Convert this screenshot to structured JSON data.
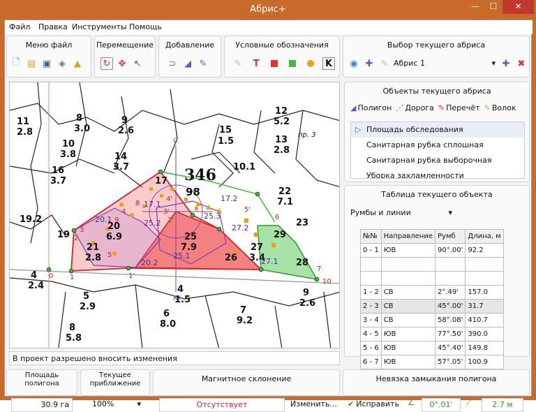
{
  "window": {
    "title": "Абрис+"
  },
  "menu": [
    "Файл",
    "Правка",
    "Инструменты",
    "Помощь"
  ],
  "toolbar_groups": {
    "file": "Меню файл",
    "move": "Перемещение",
    "add": "Добавление",
    "legend": "Условные обозначения",
    "select": "Выбор текущего абриса"
  },
  "legend_letters": {
    "t": "T",
    "k": "K"
  },
  "abris_select": {
    "value": "Абрис 1"
  },
  "objects_panel": {
    "title": "Объекты текущего абриса",
    "buttons": [
      "Полигон",
      "Дорога",
      "Перечёт",
      "Волок"
    ],
    "list": [
      "Площадь обследования",
      "Санитарная рубка сплошная",
      "Санитарная рубка выборочная",
      "Уборка захламленности"
    ]
  },
  "table_panel": {
    "title": "Таблица текущего объекта",
    "dropdown": "Румбы и линии",
    "columns": [
      "№№",
      "Направление",
      "Румб",
      "Длина, м"
    ],
    "rows": [
      [
        "0 - 1",
        "ЮВ",
        "90°.00'",
        "92.2"
      ],
      [
        "",
        "",
        "",
        ""
      ],
      [
        "",
        "",
        "",
        ""
      ],
      [
        "1 - 2",
        "СВ",
        "2°.49'",
        "157.0"
      ],
      [
        "2 - 3",
        "СВ",
        "45°.00'",
        "31.7"
      ],
      [
        "3 - 4",
        "СВ",
        "58°.08'",
        "410.7"
      ],
      [
        "4 - 5",
        "ЮВ",
        "77°.50'",
        "390.0"
      ],
      [
        "5 - 6",
        "ЮВ",
        "45°.40'",
        "149.8"
      ],
      [
        "6 - 7",
        "ЮВ",
        "57°.05'",
        "100.9"
      ]
    ]
  },
  "status": {
    "text": "В проект разрешено вносить изменения"
  },
  "bottom": {
    "area_title": "Площадь полигона",
    "area_value": "30.9 га",
    "zoom_title": "Текущее приближение",
    "zoom_value": "100%",
    "magnetic_title": "Магнитное склонение",
    "magnetic_value": "Отсутствует",
    "magnetic_button": "Изменить...",
    "closure_title": "Невязка замыкания полигона",
    "fix_button": "Исправить",
    "angle_value": "0°.01'",
    "length_value": "2.7 м"
  },
  "map": {
    "block_big_number": "346",
    "block_area": "98",
    "labels": [
      "11",
      "2.8",
      "8",
      "3.0",
      "9",
      "2.6",
      "10",
      "3.8",
      "12",
      "5.2",
      "13",
      "2.8",
      "15",
      "1.5",
      "16",
      "3.7",
      "14",
      "3.7",
      "10.1",
      "19.2",
      "19",
      "20",
      "6.9",
      "21",
      "2.8",
      "17",
      "25",
      "7.9",
      "26",
      "27",
      "3.4",
      "29",
      "28",
      "22",
      "7.1",
      "23",
      "4",
      "2.4",
      "5",
      "2.9",
      "6",
      "8.0",
      "7",
      "9.2",
      "9",
      "2.6",
      "8",
      "5.8",
      "4",
      "1.5"
    ],
    "road_label": "пр. 3",
    "north_label": "С",
    "south_label": "Ю",
    "inner_labels": [
      "17.1",
      "25.2",
      "20.1",
      "20.2",
      "25.1",
      "25.3",
      "17.2",
      "27.2",
      "27.1"
    ],
    "point_labels": [
      "0",
      "1",
      "1'",
      "2",
      "2'",
      "3",
      "3'",
      "4",
      "4'",
      "5",
      "5'",
      "6",
      "7",
      "8",
      "9",
      "10"
    ],
    "colors": {
      "red": "#e02020",
      "green": "#3cbf3c",
      "purple": "#7a3fb0",
      "orange": "#f39c12"
    }
  }
}
